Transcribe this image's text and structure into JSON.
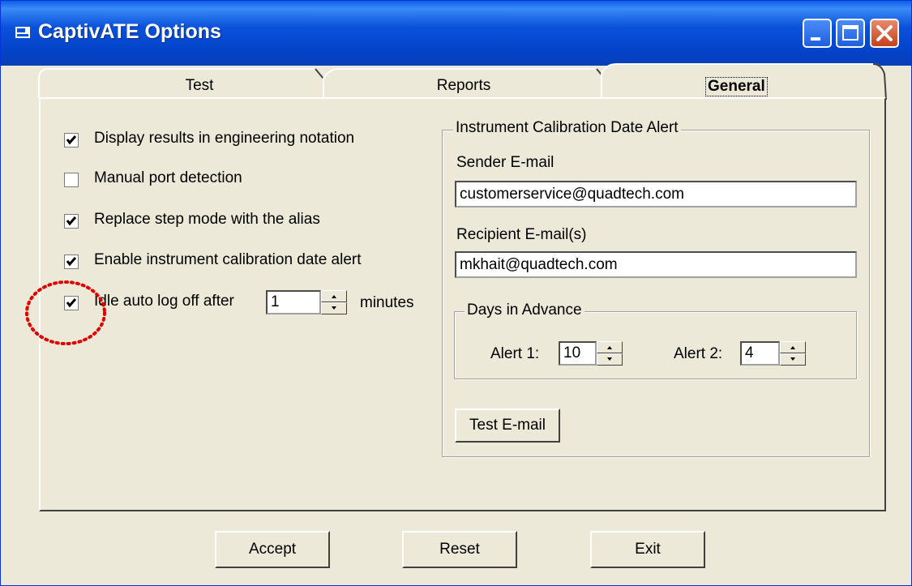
{
  "window": {
    "title": "CaptivATE Options"
  },
  "tabs": [
    {
      "label": "Test"
    },
    {
      "label": "Reports"
    },
    {
      "label": "General"
    }
  ],
  "options": [
    {
      "label": "Display results in engineering notation",
      "checked": true
    },
    {
      "label": "Manual port detection",
      "checked": false
    },
    {
      "label": "Replace step mode with the alias",
      "checked": true
    },
    {
      "label": "Enable instrument calibration date alert",
      "checked": true
    },
    {
      "label": "Idle auto log off  after",
      "checked": true
    }
  ],
  "idle": {
    "value": "1",
    "unit": "minutes"
  },
  "alert_group": {
    "title": "Instrument Calibration Date Alert",
    "sender_label": "Sender E-mail",
    "sender_value": "customerservice@quadtech.com",
    "recipient_label": "Recipient E-mail(s)",
    "recipient_value": "mkhait@quadtech.com",
    "days_title": "Days in Advance",
    "alert1_label": "Alert 1:",
    "alert1_value": "10",
    "alert2_label": "Alert 2:",
    "alert2_value": "4",
    "test_email_label": "Test E-mail"
  },
  "buttons": {
    "accept": "Accept",
    "reset": "Reset",
    "exit": "Exit"
  },
  "colors": {
    "titlebar": "#0A52DB",
    "face": "#ECE9D8",
    "annotation": "#E00000"
  }
}
